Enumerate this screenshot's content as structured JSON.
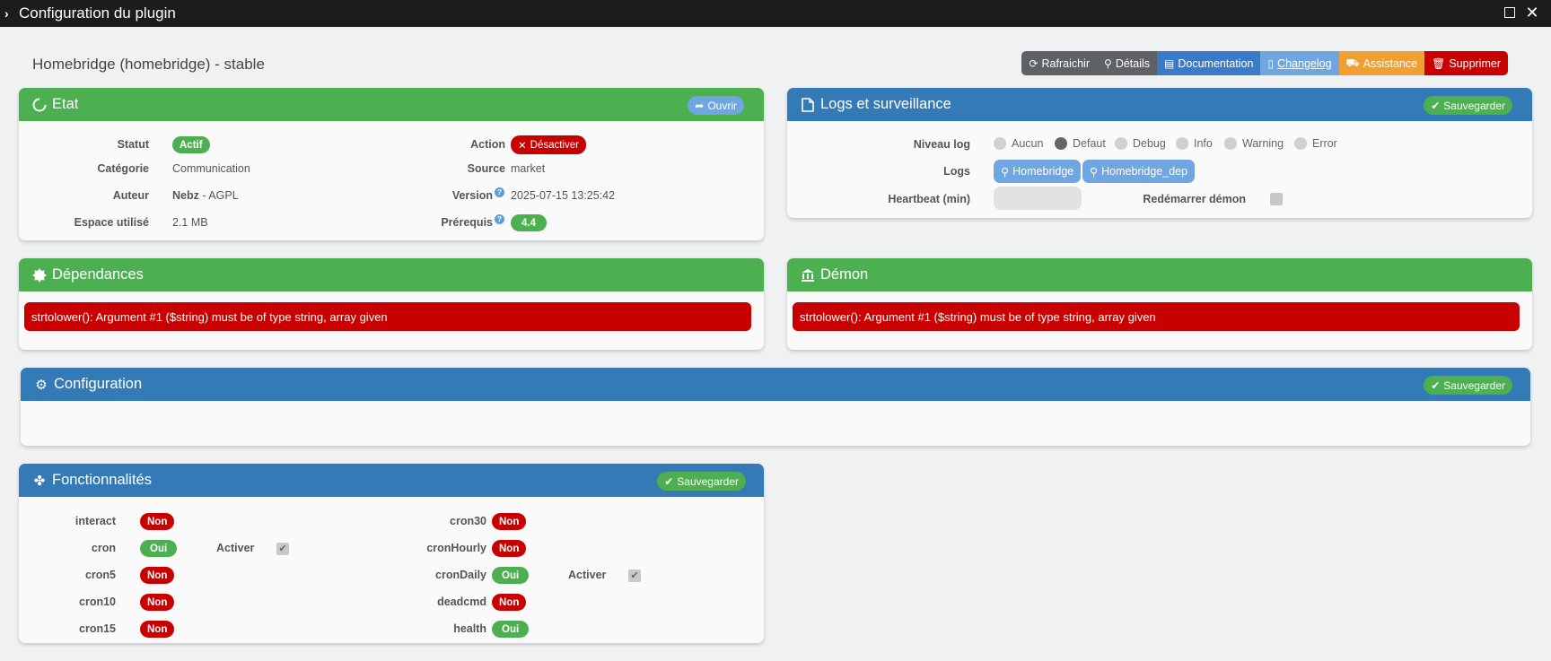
{
  "window": {
    "title": "Configuration du plugin"
  },
  "plugin_title": "Homebridge (homebridge) - stable",
  "toolbar": {
    "refresh": "Rafraichir",
    "details": "Détails",
    "documentation": "Documentation",
    "changelog": "Changelog",
    "assistance": "Assistance",
    "delete": "Supprimer"
  },
  "etat": {
    "title": "Etat",
    "open_button": "Ouvrir",
    "statut_label": "Statut",
    "statut_value": "Actif",
    "categorie_label": "Catégorie",
    "categorie_value": "Communication",
    "auteur_label": "Auteur",
    "auteur_value": "Nebz",
    "auteur_license": " - AGPL",
    "espace_label": "Espace utilisé",
    "espace_value": "2.1 MB",
    "action_label": "Action",
    "action_value": "Désactiver",
    "source_label": "Source",
    "source_value": "market",
    "version_label": "Version",
    "version_value": "2025-07-15 13:25:42",
    "prerequis_label": "Prérequis",
    "prerequis_value": "4.4"
  },
  "logs": {
    "title": "Logs et surveillance",
    "save_button": "Sauvegarder",
    "niveau_label": "Niveau log",
    "levels": [
      "Aucun",
      "Defaut",
      "Debug",
      "Info",
      "Warning",
      "Error"
    ],
    "selected_level": "Defaut",
    "logs_label": "Logs",
    "log_buttons": [
      "Homebridge",
      "Homebridge_dep"
    ],
    "heartbeat_label": "Heartbeat (min)",
    "restart_label": "Redémarrer démon"
  },
  "dependances": {
    "title": "Dépendances",
    "error": "strtolower(): Argument #1 ($string) must be of type string, array given"
  },
  "demon": {
    "title": "Démon",
    "error": "strtolower(): Argument #1 ($string) must be of type string, array given"
  },
  "configuration": {
    "title": "Configuration",
    "save_button": "Sauvegarder"
  },
  "fonctionnalites": {
    "title": "Fonctionnalités",
    "save_button": "Sauvegarder",
    "activer_label": "Activer",
    "left": [
      {
        "name": "interact",
        "value": "Non"
      },
      {
        "name": "cron",
        "value": "Oui",
        "activer": true
      },
      {
        "name": "cron5",
        "value": "Non"
      },
      {
        "name": "cron10",
        "value": "Non"
      },
      {
        "name": "cron15",
        "value": "Non"
      }
    ],
    "right": [
      {
        "name": "cron30",
        "value": "Non"
      },
      {
        "name": "cronHourly",
        "value": "Non"
      },
      {
        "name": "cronDaily",
        "value": "Oui",
        "activer": true
      },
      {
        "name": "deadcmd",
        "value": "Non"
      },
      {
        "name": "health",
        "value": "Oui"
      }
    ]
  },
  "colors": {
    "green": "#4caf50",
    "blue": "#337ab7",
    "red": "#c90000",
    "orange": "#f0a030"
  }
}
